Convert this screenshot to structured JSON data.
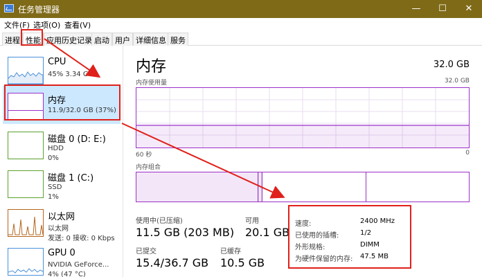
{
  "window": {
    "title": "任务管理器",
    "minimize": "—",
    "maximize": "☐",
    "close": "✕"
  },
  "menu": [
    "文件(F)",
    "选项(O)",
    "查看(V)"
  ],
  "tabs": [
    "进程",
    "性能",
    "应用历史记录",
    "启动",
    "用户",
    "详细信息",
    "服务"
  ],
  "sidebar": {
    "items": [
      {
        "name": "CPU",
        "lines": [
          "45%  3.34 GHz"
        ]
      },
      {
        "name": "内存",
        "lines": [
          "11.9/32.0 GB (37%)"
        ]
      },
      {
        "name": "磁盘 0 (D: E:)",
        "lines": [
          "HDD",
          "0%"
        ]
      },
      {
        "name": "磁盘 1 (C:)",
        "lines": [
          "SSD",
          "1%"
        ]
      },
      {
        "name": "以太网",
        "lines": [
          "以太网",
          "发送: 0 接收: 0 Kbps"
        ]
      },
      {
        "name": "GPU 0",
        "lines": [
          "NVIDIA GeForce...",
          "4% (47 °C)"
        ]
      }
    ]
  },
  "main": {
    "title": "内存",
    "total": "32.0 GB",
    "usage_label": "内存使用量",
    "usage_max": "32.0 GB",
    "time_left": "60 秒",
    "time_right": "0",
    "composition_label": "内存组合",
    "in_use_fraction": 0.37
  },
  "stats": {
    "in_use_label": "使用中(已压缩)",
    "in_use_value": "11.5 GB (203 MB)",
    "available_label": "可用",
    "available_value": "20.1 GB",
    "committed_label": "已提交",
    "committed_value": "15.4/36.7 GB",
    "cached_label": "已缓存",
    "cached_value": "10.5 GB"
  },
  "details": [
    {
      "label": "速度:",
      "value": "2400 MHz"
    },
    {
      "label": "已使用的插槽:",
      "value": "1/2"
    },
    {
      "label": "外形规格:",
      "value": "DIMM"
    },
    {
      "label": "为硬件保留的内存:",
      "value": "47.5 MB"
    }
  ],
  "colors": {
    "titlebar": "#7f6a18",
    "memory_accent": "#9b30c8",
    "selected_bg": "#cce8ff",
    "annotation_red": "#e0201a"
  }
}
